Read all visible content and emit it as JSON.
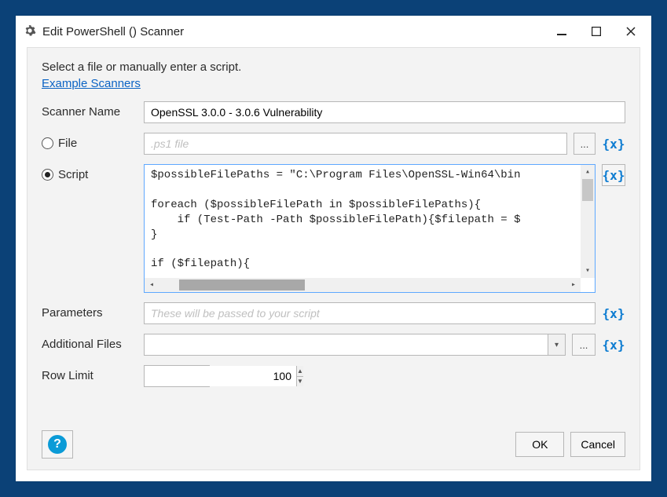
{
  "window": {
    "title": "Edit PowerShell () Scanner"
  },
  "instruction": "Select a file or manually enter a script.",
  "example_link": "Example Scanners",
  "labels": {
    "scanner_name": "Scanner Name",
    "file": "File",
    "script": "Script",
    "parameters": "Parameters",
    "additional_files": "Additional Files",
    "row_limit": "Row Limit"
  },
  "values": {
    "scanner_name": "OpenSSL 3.0.0 - 3.0.6 Vulnerability",
    "file_placeholder": ".ps1 file",
    "source_mode": "script",
    "script": "$possibleFilePaths = \"C:\\Program Files\\OpenSSL-Win64\\bin\n\nforeach ($possibleFilePath in $possibleFilePaths){\n    if (Test-Path -Path $possibleFilePath){$filepath = $\n}\n\nif ($filepath){",
    "parameters_placeholder": "These will be passed to your script",
    "additional_files": "",
    "row_limit": "100"
  },
  "buttons": {
    "browse": "...",
    "variable": "{x}",
    "ok": "OK",
    "cancel": "Cancel",
    "help": "?"
  }
}
